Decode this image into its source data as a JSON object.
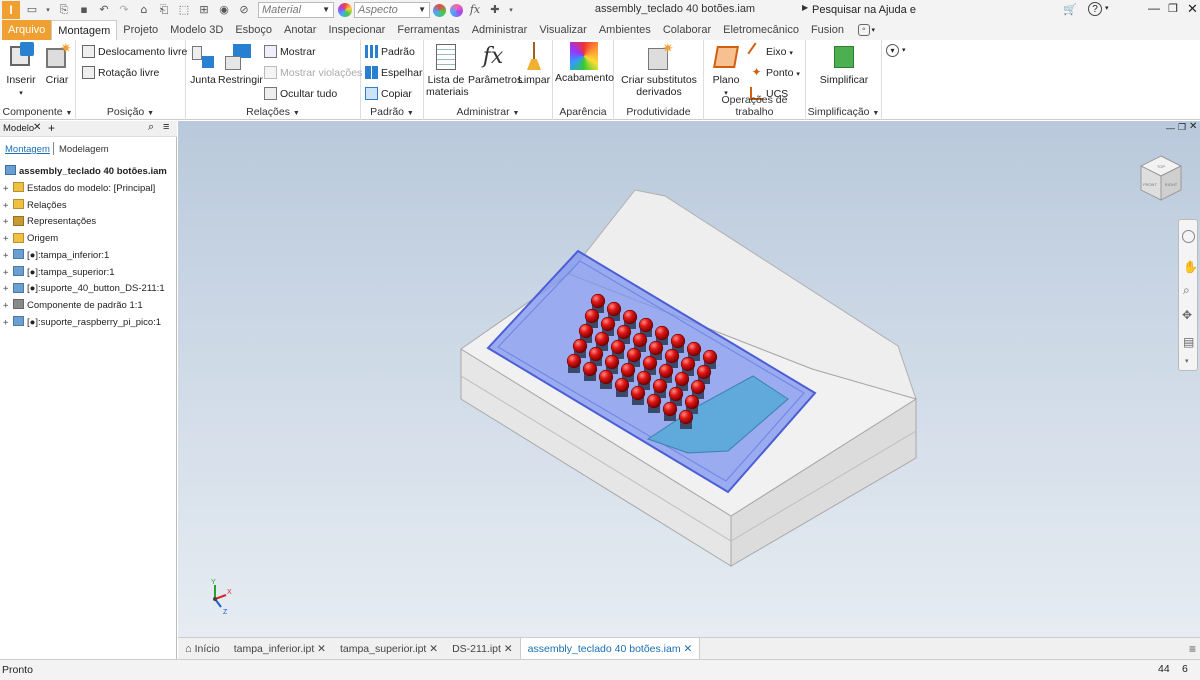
{
  "title_bar": {
    "app_logo": "I",
    "material_placeholder": "Material",
    "appearance_placeholder": "Aspecto",
    "document_title": "assembly_teclado 40 botões.iam",
    "help_search": "Pesquisar na Ajuda e comandos."
  },
  "tabs": [
    "Arquivo",
    "Montagem",
    "Projeto",
    "Modelo 3D",
    "Esboço",
    "Anotar",
    "Inspecionar",
    "Ferramentas",
    "Administrar",
    "Visualizar",
    "Ambientes",
    "Colaborar",
    "Eletromecânico",
    "Fusion"
  ],
  "active_tab": "Montagem",
  "ribbon": {
    "componente": {
      "label": "Componente",
      "inserir": "Inserir",
      "criar": "Criar"
    },
    "posicao": {
      "label": "Posição",
      "deslocamento": "Deslocamento livre",
      "rotacao": "Rotação livre"
    },
    "relacoes": {
      "label": "Relações",
      "junta": "Junta",
      "restringir": "Restringir",
      "mostrar": "Mostrar",
      "mostrar_violacoes": "Mostrar violações",
      "ocultar_tudo": "Ocultar tudo"
    },
    "padrao": {
      "label": "Padrão",
      "padrao": "Padrão",
      "espelhar": "Espelhar",
      "copiar": "Copiar"
    },
    "administrar": {
      "label": "Administrar",
      "lista": "Lista de materiais",
      "parametros": "Parâmetros",
      "limpar": "Limpar"
    },
    "aparencia": {
      "label": "Aparência",
      "acabamento": "Acabamento"
    },
    "produtividade": {
      "label": "Produtividade",
      "criar_subs": "Criar substitutos derivados"
    },
    "operacoes": {
      "label": "Operações de trabalho",
      "plano": "Plano",
      "eixo": "Eixo",
      "ponto": "Ponto",
      "ucs": "UCS"
    },
    "simplificacao": {
      "label": "Simplificação",
      "simplificar": "Simplificar"
    }
  },
  "browser": {
    "title": "Modelo",
    "tabs": [
      "Montagem",
      "Modelagem"
    ],
    "root": "assembly_teclado 40 botões.iam",
    "items": [
      {
        "label": "Estados do modelo: [Principal]",
        "icon": "folder-icon"
      },
      {
        "label": "Relações",
        "icon": "folder-icon"
      },
      {
        "label": "Representações",
        "icon": "representations-icon"
      },
      {
        "label": "Origem",
        "icon": "folder-icon"
      },
      {
        "label": "[●]:tampa_inferior:1",
        "icon": "part-icon"
      },
      {
        "label": "[●]:tampa_superior:1",
        "icon": "part-icon"
      },
      {
        "label": "[●]:suporte_40_button_DS-211:1",
        "icon": "pattern-part-icon"
      },
      {
        "label": "Componente de padrão 1:1",
        "icon": "pattern-icon"
      },
      {
        "label": "[●]:suporte_raspberry_pi_pico:1",
        "icon": "part-icon"
      }
    ]
  },
  "viewcube": {
    "front": "FRONT",
    "top": "TOP",
    "right": "RIGHT"
  },
  "triad": {
    "x": "X",
    "y": "Y",
    "z": "Z"
  },
  "doc_tabs": [
    "Início",
    "tampa_inferior.ipt",
    "tampa_superior.ipt",
    "DS-211.ipt",
    "assembly_teclado 40 botões.iam"
  ],
  "active_doc": "assembly_teclado 40 botões.iam",
  "status": {
    "text": "Pronto",
    "count1": "44",
    "count2": "6"
  },
  "colors": {
    "accent": "#f0a030",
    "link": "#1a6fb3",
    "button_red": "#d01010"
  }
}
